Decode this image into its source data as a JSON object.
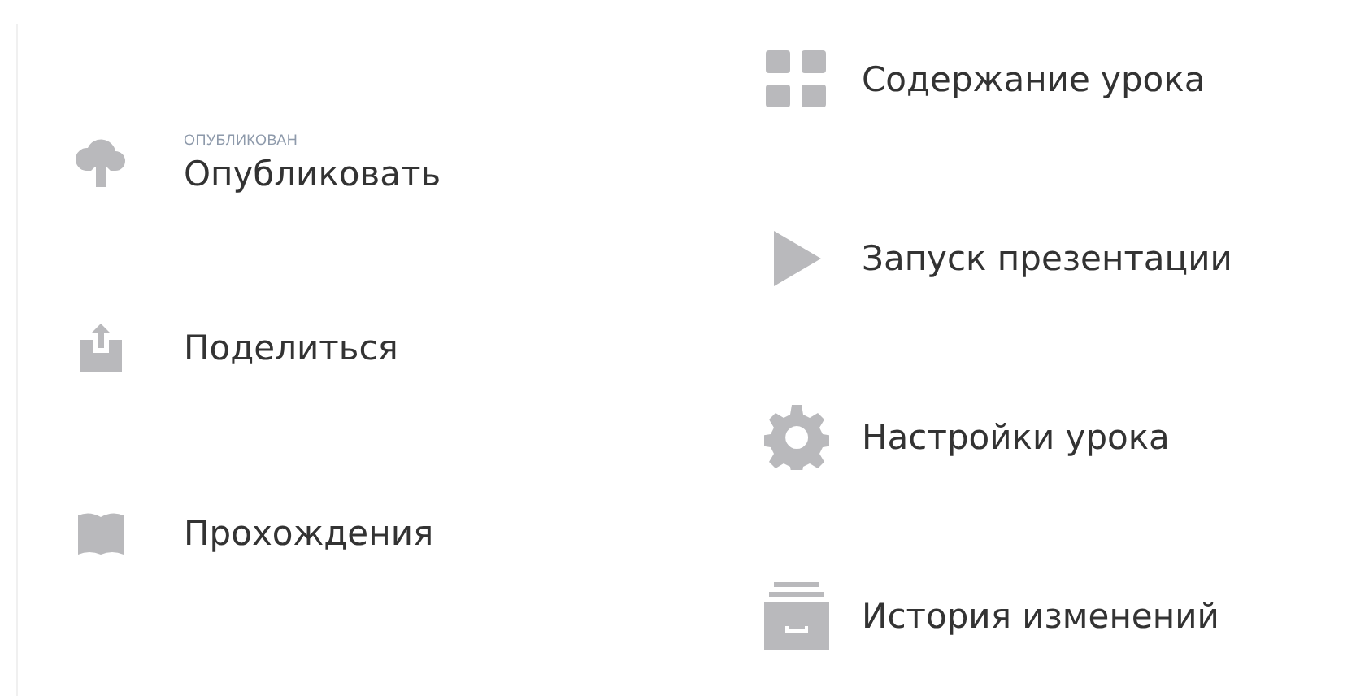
{
  "left_menu": [
    {
      "label": "Опубликовать",
      "status": "ОПУБЛИКОВАН"
    },
    {
      "label": "Поделиться"
    },
    {
      "label": "Прохождения"
    }
  ],
  "right_menu": [
    {
      "label": "Содержание урока"
    },
    {
      "label": "Запуск презентации"
    },
    {
      "label": "Настройки урока"
    },
    {
      "label": "История изменений"
    }
  ]
}
